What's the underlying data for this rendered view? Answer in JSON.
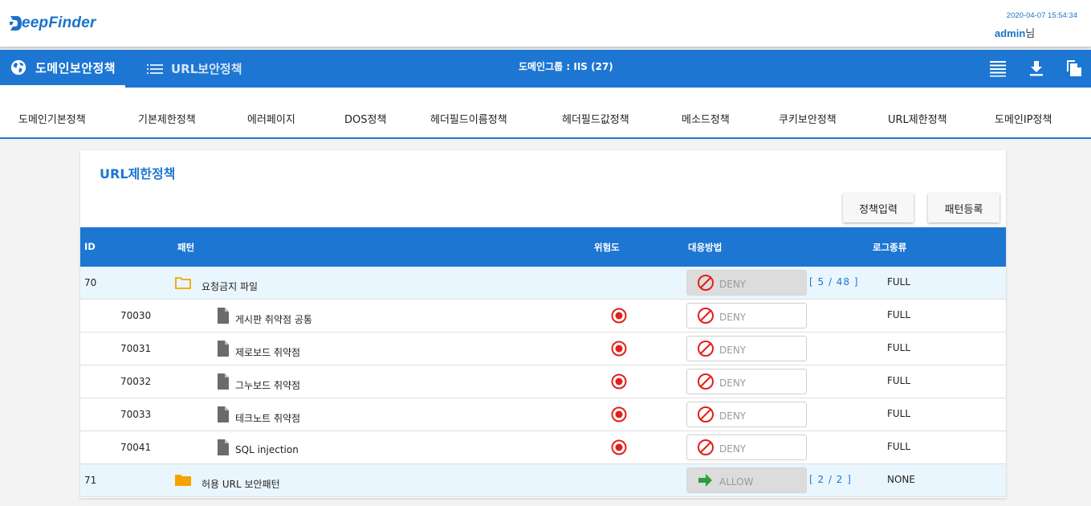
{
  "header": {
    "logo_text": "eepFinder",
    "datetime": "2020-04-07 15:54:34",
    "user_name": "admin",
    "user_suffix": "님"
  },
  "nav": {
    "primary_tab": "도메인보안정책",
    "secondary_tab": "URL보안정책",
    "group_title": "도메인그룹 : IIS (27)",
    "icons": [
      "list-icon",
      "download-icon",
      "copy-icon"
    ]
  },
  "subtabs": [
    "도메인기본정책",
    "기본제한정책",
    "에러페이지",
    "DOS정책",
    "헤더필드이름정책",
    "헤더필드값정책",
    "메소드정책",
    "쿠키보안정책",
    "URL제한정책",
    "도메인IP정책"
  ],
  "card": {
    "title": "URL제한정책",
    "btn_policy": "정책입력",
    "btn_pattern": "패턴등록"
  },
  "table": {
    "headers": {
      "id": "ID",
      "pattern": "패턴",
      "risk": "위험도",
      "action": "대응방법",
      "log": "로그종류"
    },
    "rows": [
      {
        "id": "70",
        "type": "group",
        "icon": "folder-outline-icon",
        "name": "요청금지 파일",
        "action": "DENY",
        "count": "[ 5 / 48 ]",
        "log": "FULL"
      },
      {
        "id": "70030",
        "type": "item",
        "icon": "file-icon",
        "name": "게시판 취약점 공통",
        "risk": "high",
        "action": "DENY",
        "log": "FULL"
      },
      {
        "id": "70031",
        "type": "item",
        "icon": "file-icon",
        "name": "제로보드 취약점",
        "risk": "high",
        "action": "DENY",
        "log": "FULL"
      },
      {
        "id": "70032",
        "type": "item",
        "icon": "file-icon",
        "name": "그누보드 취약점",
        "risk": "high",
        "action": "DENY",
        "log": "FULL"
      },
      {
        "id": "70033",
        "type": "item",
        "icon": "file-icon",
        "name": "테크노트 취약점",
        "risk": "high",
        "action": "DENY",
        "log": "FULL"
      },
      {
        "id": "70041",
        "type": "item",
        "icon": "file-icon",
        "name": "SQL injection",
        "risk": "high",
        "action": "DENY",
        "log": "FULL"
      },
      {
        "id": "71",
        "type": "group",
        "icon": "folder-filled-icon",
        "name": "허용 URL 보안패턴",
        "action": "ALLOW",
        "count": "[ 2 / 2 ]",
        "log": "NONE"
      }
    ]
  },
  "colors": {
    "brand": "#1d76d2",
    "risk_high": "#e0201b",
    "deny": "#e0201b",
    "allow": "#2e9e3a",
    "folder": "#f5a300"
  }
}
